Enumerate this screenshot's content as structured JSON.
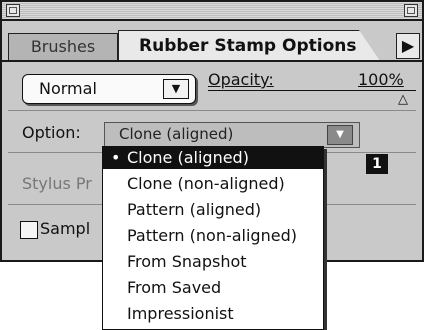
{
  "tabs": {
    "brushes": "Brushes",
    "options": "Rubber Stamp Options",
    "menu_arrow": "▶"
  },
  "mode": {
    "value": "Normal",
    "arrow": "▼"
  },
  "opacity": {
    "label": "Opacity:",
    "value": "100%",
    "thumb": "△"
  },
  "option": {
    "label": "Option:",
    "value": "Clone (aligned)",
    "arrow": "▼"
  },
  "stylus": {
    "label": "Stylus Pr"
  },
  "badge": "1",
  "sample": {
    "label": "Sampl",
    "checked": false
  },
  "menu": {
    "items": [
      {
        "label": "Clone (aligned)",
        "selected": true
      },
      {
        "label": "Clone (non-aligned)"
      },
      {
        "label": "Pattern (aligned)"
      },
      {
        "label": "Pattern (non-aligned)"
      },
      {
        "label": "From Snapshot"
      },
      {
        "label": "From Saved"
      },
      {
        "label": "Impressionist"
      }
    ],
    "bullet": "•"
  }
}
